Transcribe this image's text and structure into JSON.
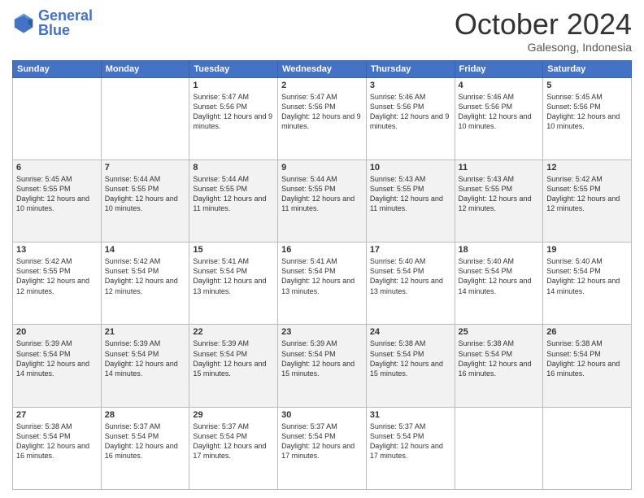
{
  "header": {
    "logo_general": "General",
    "logo_blue": "Blue",
    "month": "October 2024",
    "location": "Galesong, Indonesia"
  },
  "days_of_week": [
    "Sunday",
    "Monday",
    "Tuesday",
    "Wednesday",
    "Thursday",
    "Friday",
    "Saturday"
  ],
  "weeks": [
    [
      {
        "day": "",
        "sunrise": "",
        "sunset": "",
        "daylight": ""
      },
      {
        "day": "",
        "sunrise": "",
        "sunset": "",
        "daylight": ""
      },
      {
        "day": "1",
        "sunrise": "Sunrise: 5:47 AM",
        "sunset": "Sunset: 5:56 PM",
        "daylight": "Daylight: 12 hours and 9 minutes."
      },
      {
        "day": "2",
        "sunrise": "Sunrise: 5:47 AM",
        "sunset": "Sunset: 5:56 PM",
        "daylight": "Daylight: 12 hours and 9 minutes."
      },
      {
        "day": "3",
        "sunrise": "Sunrise: 5:46 AM",
        "sunset": "Sunset: 5:56 PM",
        "daylight": "Daylight: 12 hours and 9 minutes."
      },
      {
        "day": "4",
        "sunrise": "Sunrise: 5:46 AM",
        "sunset": "Sunset: 5:56 PM",
        "daylight": "Daylight: 12 hours and 10 minutes."
      },
      {
        "day": "5",
        "sunrise": "Sunrise: 5:45 AM",
        "sunset": "Sunset: 5:56 PM",
        "daylight": "Daylight: 12 hours and 10 minutes."
      }
    ],
    [
      {
        "day": "6",
        "sunrise": "Sunrise: 5:45 AM",
        "sunset": "Sunset: 5:55 PM",
        "daylight": "Daylight: 12 hours and 10 minutes."
      },
      {
        "day": "7",
        "sunrise": "Sunrise: 5:44 AM",
        "sunset": "Sunset: 5:55 PM",
        "daylight": "Daylight: 12 hours and 10 minutes."
      },
      {
        "day": "8",
        "sunrise": "Sunrise: 5:44 AM",
        "sunset": "Sunset: 5:55 PM",
        "daylight": "Daylight: 12 hours and 11 minutes."
      },
      {
        "day": "9",
        "sunrise": "Sunrise: 5:44 AM",
        "sunset": "Sunset: 5:55 PM",
        "daylight": "Daylight: 12 hours and 11 minutes."
      },
      {
        "day": "10",
        "sunrise": "Sunrise: 5:43 AM",
        "sunset": "Sunset: 5:55 PM",
        "daylight": "Daylight: 12 hours and 11 minutes."
      },
      {
        "day": "11",
        "sunrise": "Sunrise: 5:43 AM",
        "sunset": "Sunset: 5:55 PM",
        "daylight": "Daylight: 12 hours and 12 minutes."
      },
      {
        "day": "12",
        "sunrise": "Sunrise: 5:42 AM",
        "sunset": "Sunset: 5:55 PM",
        "daylight": "Daylight: 12 hours and 12 minutes."
      }
    ],
    [
      {
        "day": "13",
        "sunrise": "Sunrise: 5:42 AM",
        "sunset": "Sunset: 5:55 PM",
        "daylight": "Daylight: 12 hours and 12 minutes."
      },
      {
        "day": "14",
        "sunrise": "Sunrise: 5:42 AM",
        "sunset": "Sunset: 5:54 PM",
        "daylight": "Daylight: 12 hours and 12 minutes."
      },
      {
        "day": "15",
        "sunrise": "Sunrise: 5:41 AM",
        "sunset": "Sunset: 5:54 PM",
        "daylight": "Daylight: 12 hours and 13 minutes."
      },
      {
        "day": "16",
        "sunrise": "Sunrise: 5:41 AM",
        "sunset": "Sunset: 5:54 PM",
        "daylight": "Daylight: 12 hours and 13 minutes."
      },
      {
        "day": "17",
        "sunrise": "Sunrise: 5:40 AM",
        "sunset": "Sunset: 5:54 PM",
        "daylight": "Daylight: 12 hours and 13 minutes."
      },
      {
        "day": "18",
        "sunrise": "Sunrise: 5:40 AM",
        "sunset": "Sunset: 5:54 PM",
        "daylight": "Daylight: 12 hours and 14 minutes."
      },
      {
        "day": "19",
        "sunrise": "Sunrise: 5:40 AM",
        "sunset": "Sunset: 5:54 PM",
        "daylight": "Daylight: 12 hours and 14 minutes."
      }
    ],
    [
      {
        "day": "20",
        "sunrise": "Sunrise: 5:39 AM",
        "sunset": "Sunset: 5:54 PM",
        "daylight": "Daylight: 12 hours and 14 minutes."
      },
      {
        "day": "21",
        "sunrise": "Sunrise: 5:39 AM",
        "sunset": "Sunset: 5:54 PM",
        "daylight": "Daylight: 12 hours and 14 minutes."
      },
      {
        "day": "22",
        "sunrise": "Sunrise: 5:39 AM",
        "sunset": "Sunset: 5:54 PM",
        "daylight": "Daylight: 12 hours and 15 minutes."
      },
      {
        "day": "23",
        "sunrise": "Sunrise: 5:39 AM",
        "sunset": "Sunset: 5:54 PM",
        "daylight": "Daylight: 12 hours and 15 minutes."
      },
      {
        "day": "24",
        "sunrise": "Sunrise: 5:38 AM",
        "sunset": "Sunset: 5:54 PM",
        "daylight": "Daylight: 12 hours and 15 minutes."
      },
      {
        "day": "25",
        "sunrise": "Sunrise: 5:38 AM",
        "sunset": "Sunset: 5:54 PM",
        "daylight": "Daylight: 12 hours and 16 minutes."
      },
      {
        "day": "26",
        "sunrise": "Sunrise: 5:38 AM",
        "sunset": "Sunset: 5:54 PM",
        "daylight": "Daylight: 12 hours and 16 minutes."
      }
    ],
    [
      {
        "day": "27",
        "sunrise": "Sunrise: 5:38 AM",
        "sunset": "Sunset: 5:54 PM",
        "daylight": "Daylight: 12 hours and 16 minutes."
      },
      {
        "day": "28",
        "sunrise": "Sunrise: 5:37 AM",
        "sunset": "Sunset: 5:54 PM",
        "daylight": "Daylight: 12 hours and 16 minutes."
      },
      {
        "day": "29",
        "sunrise": "Sunrise: 5:37 AM",
        "sunset": "Sunset: 5:54 PM",
        "daylight": "Daylight: 12 hours and 17 minutes."
      },
      {
        "day": "30",
        "sunrise": "Sunrise: 5:37 AM",
        "sunset": "Sunset: 5:54 PM",
        "daylight": "Daylight: 12 hours and 17 minutes."
      },
      {
        "day": "31",
        "sunrise": "Sunrise: 5:37 AM",
        "sunset": "Sunset: 5:54 PM",
        "daylight": "Daylight: 12 hours and 17 minutes."
      },
      {
        "day": "",
        "sunrise": "",
        "sunset": "",
        "daylight": ""
      },
      {
        "day": "",
        "sunrise": "",
        "sunset": "",
        "daylight": ""
      }
    ]
  ]
}
